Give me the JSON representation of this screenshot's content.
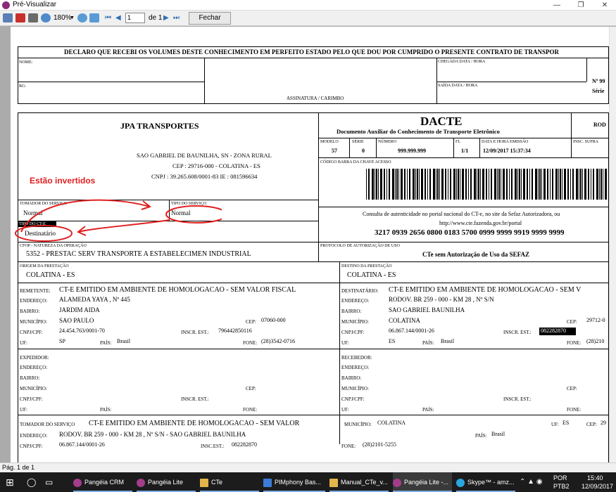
{
  "window": {
    "title": "Pré-Visualizar",
    "min": "—",
    "max": "❐",
    "close": "✕"
  },
  "toolbar": {
    "zoom": "180%",
    "page_input": "1",
    "page_of": "de 1",
    "close_label": "Fechar"
  },
  "status": {
    "text": "Pág. 1 de 1"
  },
  "doc": {
    "declaro": "DECLARO QUE RECEBI OS VOLUMES DESTE CONHECIMENTO EM PERFEITO ESTADO PELO QUE DOU POR CUMPRIDO O PRESENTE CONTRATO DE TRANSPOR",
    "nome_label": "NOME:",
    "rg_label": "RG:",
    "assinatura_label": "ASSINATURA / CARIMBO",
    "chegada_label": "CHEGADA DATA / HORA",
    "saida_label": "SAÍDA DATA / HORA",
    "numero_short": "Nº 99",
    "serie_short": "Série",
    "empresa": "JPA TRANSPORTES",
    "endereco": "SAO GABRIEL DE BAUNILHA, SN - ZONA RURAL",
    "cep": "CEP : 29716-000 - COLATINA - ES",
    "cnpj": "CNPJ : 39.265.608/0001-83 IE : 081596634",
    "dacte_title": "DACTE",
    "dacte_sub": "Documento Auxiliar do Conhecimento de Transporte Eletrônico",
    "rod": "ROD",
    "modelo_label": "MODELO",
    "modelo": "57",
    "serie_label": "SÉRIE",
    "serie": "0",
    "numero_label": "NÚMERO",
    "numero": "999.999.999",
    "fl_label": "FL",
    "fl": "1/1",
    "data_label": "DATA E HORA EMISSÃO",
    "data": "12/09/2017 15:37:34",
    "insc_label": "INSC. SUFRA",
    "codigo_label": "CÓDIGO BARRA DA CHAVE ACESSO",
    "consulta": "Consulta de autenticidade no portal nacional do CT-e, no site da Sefaz Autorizadora, ou",
    "portal": "http://www.cte.fazenda.gov.br/portal",
    "chave": "3217 0939 2656 0800 0183 5700 0999 9999 9919 9999 9999",
    "annotation": "Estão invertidos",
    "tomador_label": "TOMADOR DO SERVIÇO",
    "tomador": "Normal",
    "tipo_serv_label": "TIPO DO SERVIÇO",
    "tipo_serv": "Normal",
    "tipo_cte_label": "TIPO DO CT-E",
    "tipo_cte": "Destinatário",
    "cfop_label": "CFOP - NATUREZA DA OPERAÇÃO",
    "cfop": "5352 - PRESTAC SERV TRANSPORTE A ESTABELECIMEN INDUSTRIAL",
    "protocolo_label": "PROTOCOLO DE AUTORIZAÇÃO DE USO",
    "protocolo": "CTe sem Autorização de Uso da SEFAZ",
    "origem_label": "ORIGEM DA PRESTAÇÃO",
    "origem": "COLATINA - ES",
    "destino_label": "DESTINO DA PRESTAÇÃO",
    "destino": "COLATINA - ES",
    "rem": {
      "label": "REMETENTE:",
      "nome": "CT-E EMITIDO EM AMBIENTE DE HOMOLOGACAO - SEM VALOR FISCAL",
      "end_label": "ENDEREÇO:",
      "end": "ALAMEDA YAYA , Nº 445",
      "bairro_label": "BAIRRO:",
      "bairro": "JARDIM AIDA",
      "mun_label": "MUNICÍPIO:",
      "mun": "SAO PAULO",
      "cep_label": "CEP:",
      "cep": "07060-000",
      "cnpj_label": "CNPJ/CPF:",
      "cnpj": "24.454.763/0001-70",
      "ie_label": "INSCR. EST.:",
      "ie": "796442850116",
      "uf_label": "UF:",
      "uf": "SP",
      "pais_label": "PAÍS:",
      "pais": "Brasil",
      "fone_label": "FONE:",
      "fone": "(28)3542-0716"
    },
    "dest": {
      "label": "DESTINATÁRIO:",
      "nome": "CT-E EMITIDO EM AMBIENTE DE HOMOLOGACAO - SEM V",
      "end_label": "ENDEREÇO:",
      "end": "RODOV. BR 259 - 000 - KM 28 , Nº S/N",
      "bairro_label": "BAIRRO:",
      "bairro": "SAO GABRIEL BAUNILHA",
      "mun_label": "MUNICÍPIO:",
      "mun": "COLATINA",
      "cep_label": "CEP:",
      "cep": "29712-0",
      "cnpj_label": "CNPJ/CPF:",
      "cnpj": "06.867.144/0001-26",
      "ie_label": "INSCR. EST.:",
      "ie": "082282870",
      "uf_label": "UF:",
      "uf": "ES",
      "pais_label": "PAÍS:",
      "pais": "Brasil",
      "fone_label": "FONE:",
      "fone": "(28)210"
    },
    "exp": {
      "label": "EXPEDIDOR:",
      "end_label": "ENDEREÇO:",
      "bairro_label": "BAIRRO:",
      "mun_label": "MUNICÍPIO:",
      "cep_label": "CEP:",
      "cnpj_label": "CNPJ/CPF:",
      "ie_label": "INSCR. EST.:",
      "uf_label": "UF:",
      "pais_label": "PAÍS:",
      "fone_label": "FONE:"
    },
    "rec": {
      "label": "RECEBEDOR:",
      "end_label": "ENDEREÇO:",
      "bairro_label": "BAIRRO:",
      "mun_label": "MUNICÍPIO:",
      "cep_label": "CEP:",
      "cnpj_label": "CNPJ/CPF:",
      "ie_label": "INSCR. EST.:",
      "uf_label": "UF:",
      "pais_label": "PAÍS:",
      "fone_label": "FONE:"
    },
    "tom": {
      "label": "TOMADOR DO SERVIÇO",
      "nome": "CT-E EMITIDO EM AMBIENTE DE HOMOLOGACAO - SEM VALOR",
      "mun_label": "MUNICÍPIO:",
      "mun": "COLATINA",
      "uf_label": "UF:",
      "uf": "ES",
      "cep_label": "CEP:",
      "cep": "29",
      "end_label": "ENDEREÇO:",
      "end": "RODOV. BR 259 - 000 - KM 28 , Nº S/N - SAO GABRIEL BAUNILHA",
      "pais_label": "PAÍS:",
      "pais": "Brasil",
      "cnpj_label": "CNPJ/CPF:",
      "cnpj": "06.867.144/0001-26",
      "ie_label": "INSC.EST.:",
      "ie": "082282870",
      "fone_label": "FONE:",
      "fone": "(28)2101-5255"
    }
  },
  "taskbar": {
    "items": [
      {
        "label": "Pangéia CRM"
      },
      {
        "label": "Pangéia Lite"
      },
      {
        "label": "CTe"
      },
      {
        "label": "PIMphony Bas..."
      },
      {
        "label": "Manual_CTe_v..."
      },
      {
        "label": "Pangéia Lite -..."
      },
      {
        "label": "Skype™ - amz..."
      }
    ],
    "lang1": "POR",
    "lang2": "PTB2",
    "time": "15:40",
    "date": "12/09/2017"
  }
}
